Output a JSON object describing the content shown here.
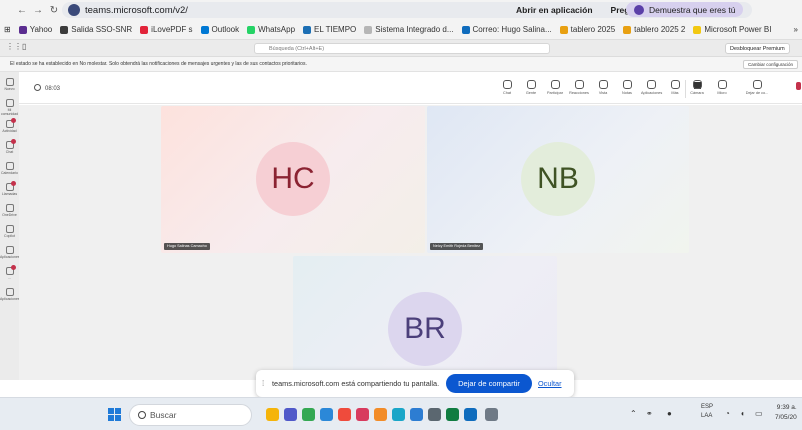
{
  "browser": {
    "url": "teams.microsoft.com/v2/",
    "actions": {
      "open_app": "Abrir en aplicación",
      "ask_google": "Preguntar a Google",
      "profile": "Demuestra que eres tú"
    },
    "bookmarks": [
      "Yahoo",
      "Salida SSO-SNR",
      "iLovePDF s",
      "Outlook",
      "WhatsApp",
      "EL TIEMPO",
      "Sistema Integrado d...",
      "Correo: Hugo Salina...",
      "tablero 2025",
      "tablero 2025 2",
      "Microsoft Power BI"
    ],
    "bookmark_colors": [
      "#5b2d90",
      "#3c3c3c",
      "#e2243a",
      "#0078d4",
      "#25d366",
      "#1c6fb4",
      "#b6b6b6",
      "#0f6cbd",
      "#e8a012",
      "#e8a012",
      "#f2c811"
    ],
    "more_bookmarks": "»"
  },
  "teams": {
    "search_placeholder": "Búsqueda (Ctrl+Alt+E)",
    "premium_label": "Desbloquear Premium",
    "notice": "El estado se ha establecido en No molestar. Solo obtendrá las notificaciones de mensajes urgentes y las de sus contactos prioritarios.",
    "notice_button": "Cambiar configuración",
    "rail": [
      "Nuevo",
      "Mi comunidad",
      "Actividad",
      "Chat",
      "Calendario",
      "Llamadas",
      "OneDrive",
      "Copilot",
      "Aplicaciones",
      "...",
      "Aplicaciones"
    ],
    "timer": "08:03",
    "toolbar": [
      "Chat",
      "Gente",
      "Participar",
      "Reacciones",
      "Vista",
      "Notas",
      "Aplicaciones",
      "Más",
      "Cámara",
      "Micro",
      "Dejar de co..."
    ],
    "participants": [
      {
        "initials": "HC",
        "name": "Hugo Salinas Camacho"
      },
      {
        "initials": "NB",
        "name": "Nelcy Emith Rojeda Benitez"
      },
      {
        "initials": "BR",
        "name": ""
      }
    ],
    "share": {
      "text": "teams.microsoft.com está compartiendo tu pantalla.",
      "stop": "Dejar de compartir",
      "hide": "Ocultar"
    }
  },
  "taskbar": {
    "search_placeholder": "Buscar",
    "language_line1": "ESP",
    "language_line2": "LAA",
    "time": "9:39 a.",
    "date": "7/05/20"
  },
  "colors": {
    "accent_blue": "#0b57d0",
    "teams_red": "#c4314b"
  }
}
